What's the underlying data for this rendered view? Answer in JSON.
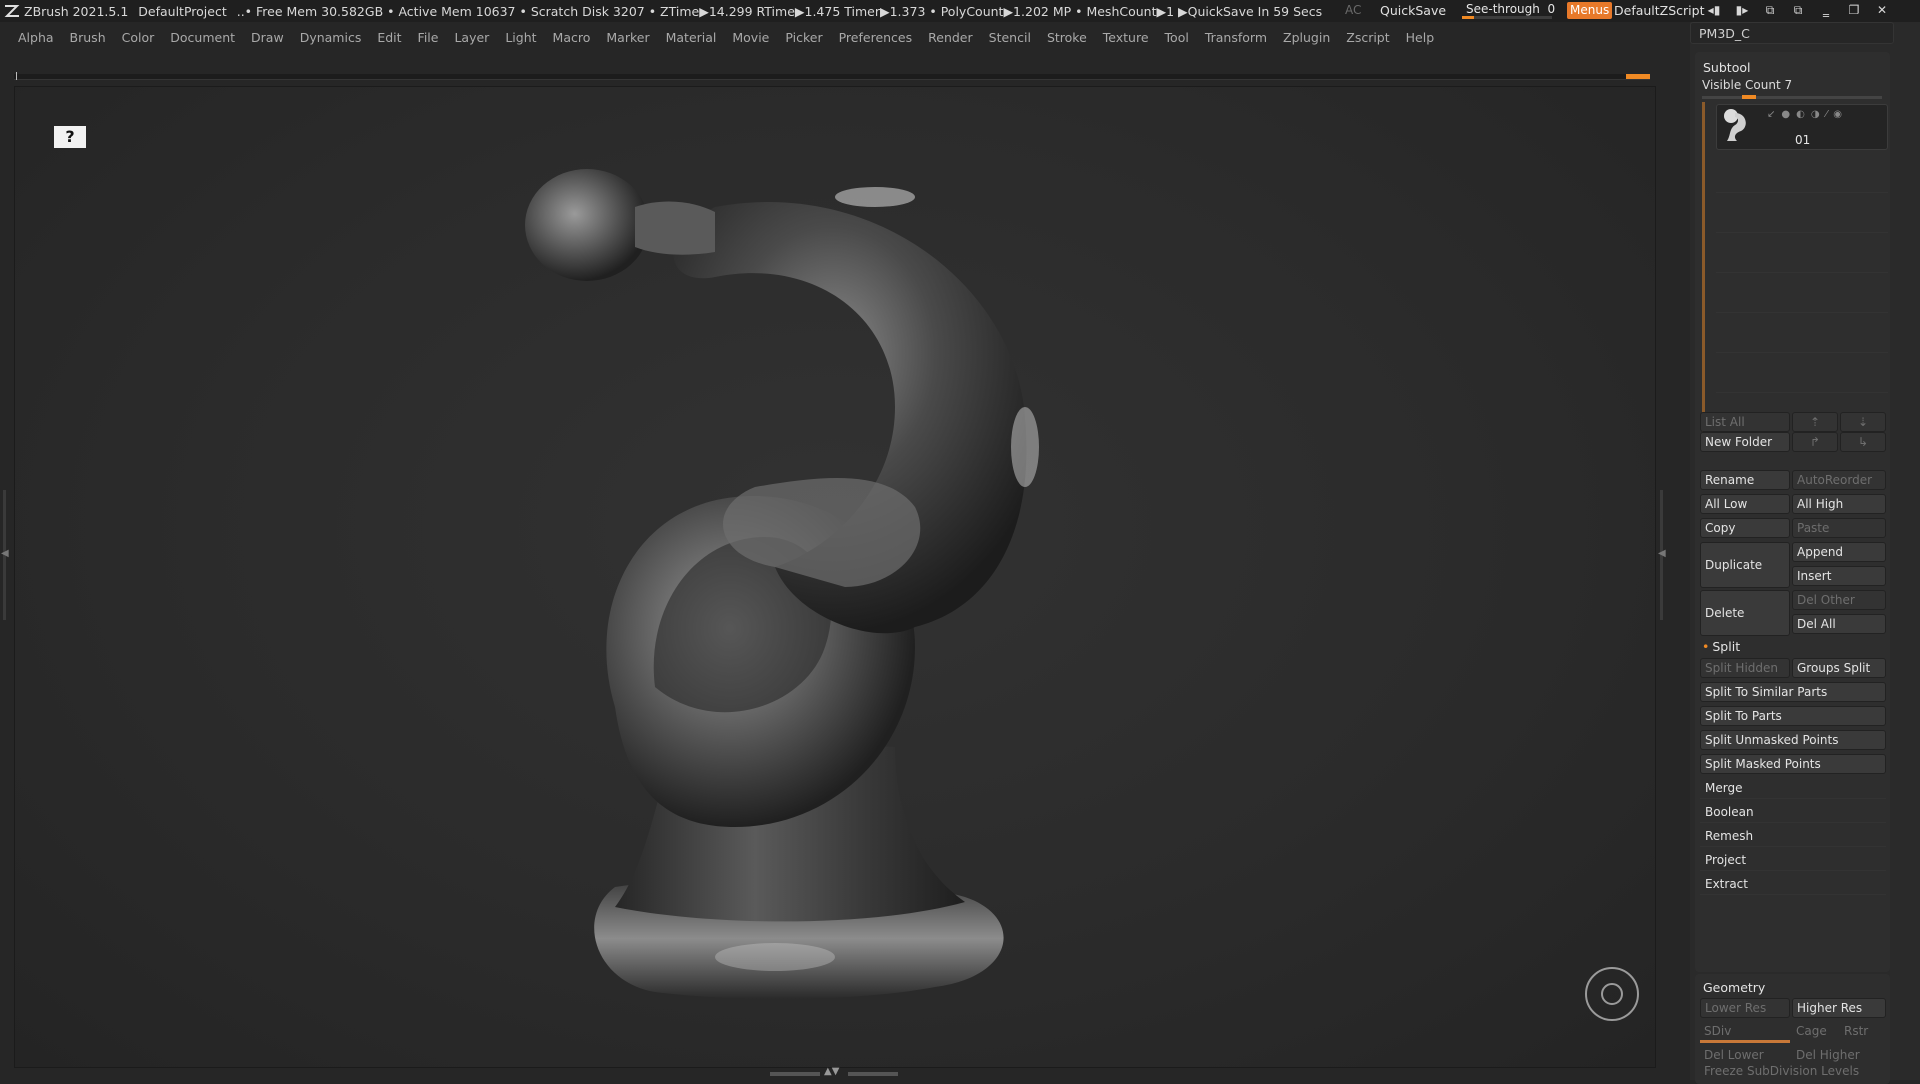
{
  "titlebar": {
    "app": "ZBrush 2021.5.1",
    "project": "DefaultProject",
    "status": "..• Free Mem 30.582GB • Active Mem 10637 • Scratch Disk 3207 • ZTime▶14.299 RTime▶1.475 Timer▶1.373 • PolyCount▶1.202 MP • MeshCount▶1  ▶QuickSave In 59 Secs",
    "ac": "AC",
    "quicksave": "QuickSave",
    "see_through_label": "See-through",
    "see_through_value": "0",
    "menus": "Menus",
    "default_zscript": "DefaultZScript"
  },
  "menubar": {
    "items": [
      "Alpha",
      "Brush",
      "Color",
      "Document",
      "Draw",
      "Dynamics",
      "Edit",
      "File",
      "Layer",
      "Light",
      "Macro",
      "Marker",
      "Material",
      "Movie",
      "Picker",
      "Preferences",
      "Render",
      "Stencil",
      "Stroke",
      "Texture",
      "Tool",
      "Transform",
      "Zplugin",
      "Zscript",
      "Help"
    ]
  },
  "canvas": {
    "help_badge": "?"
  },
  "panel": {
    "tray_title": "PM3D_C",
    "subtool": {
      "title": "Subtool",
      "visible_count": "Visible Count 7",
      "item_name": "01",
      "list_all": "List All",
      "new_folder": "New Folder",
      "rename": "Rename",
      "auto_reorder": "AutoReorder",
      "all_low": "All Low",
      "all_high": "All High",
      "copy": "Copy",
      "paste": "Paste",
      "duplicate": "Duplicate",
      "append": "Append",
      "insert": "Insert",
      "delete": "Delete",
      "del_other": "Del Other",
      "del_all": "Del All",
      "split": "Split",
      "split_hidden": "Split Hidden",
      "groups_split": "Groups Split",
      "split_similar": "Split To Similar Parts",
      "split_parts": "Split To Parts",
      "split_unmasked": "Split Unmasked Points",
      "split_masked": "Split Masked Points",
      "merge": "Merge",
      "boolean": "Boolean",
      "remesh": "Remesh",
      "project": "Project",
      "extract": "Extract"
    },
    "geometry": {
      "title": "Geometry",
      "lower_res": "Lower Res",
      "higher_res": "Higher Res",
      "sdiv": "SDiv",
      "cage": "Cage",
      "rstr": "Rstr",
      "del_lower": "Del Lower",
      "del_higher": "Del Higher",
      "freeze": "Freeze SubDivision Levels"
    }
  },
  "colors": {
    "accent": "#f08a24",
    "menus_bg": "#e8792a",
    "canvas_bg": "#2b2b2b"
  }
}
